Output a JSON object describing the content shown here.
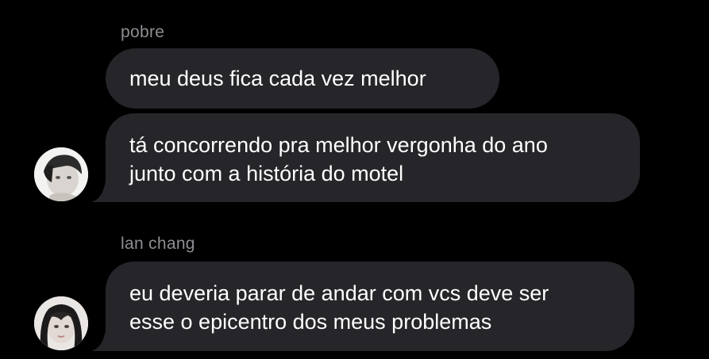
{
  "groups": [
    {
      "sender": "pobre",
      "messages": [
        "meu deus fica cada vez melhor",
        [
          "tá concorrendo pra melhor vergonha do ano",
          "junto com a história do motel"
        ]
      ],
      "avatar": "avatar-photo-1"
    },
    {
      "sender": "lan chang",
      "messages": [
        [
          "eu deveria parar de andar com vcs deve ser",
          "esse o epicentro dos meus problemas"
        ]
      ],
      "avatar": "avatar-photo-2"
    }
  ],
  "colors": {
    "background": "#000000",
    "bubble": "#26252a",
    "sender_name": "#8e8e93",
    "text": "#ffffff"
  }
}
